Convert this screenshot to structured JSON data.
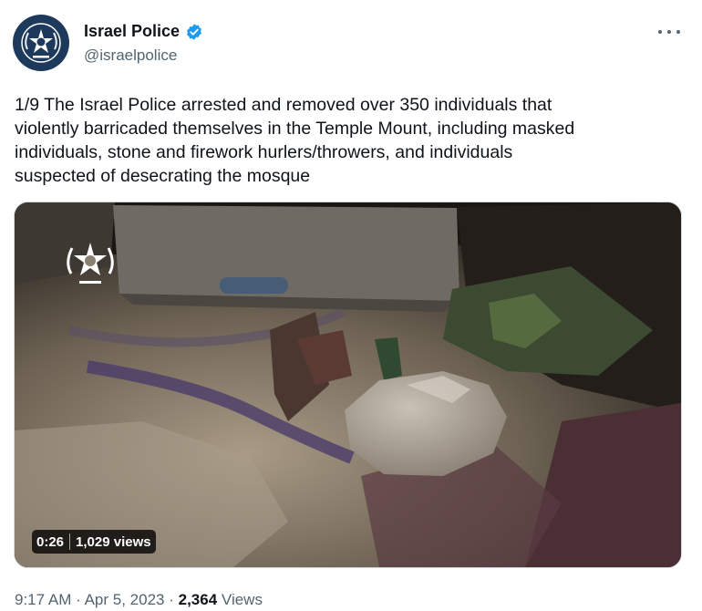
{
  "author": {
    "display_name": "Israel Police",
    "handle": "@israelpolice"
  },
  "tweet": {
    "text": "1/9 The Israel Police arrested and removed over 350 individuals that\nviolently barricaded themselves in the Temple Mount, including masked\nindividuals, stone and firework hurlers/throwers, and individuals\nsuspected of desecrating the mosque"
  },
  "media": {
    "duration": "0:26",
    "views": "1,029 views"
  },
  "meta": {
    "time": "9:17 AM",
    "date": "Apr 5, 2023",
    "view_count": "2,364",
    "views_label": "Views",
    "separator": "·"
  },
  "icons": {
    "verified": "verified-badge-icon",
    "more": "more-options-icon",
    "police_emblem": "police-star-emblem-icon"
  },
  "colors": {
    "verified_blue": "#1d9bf0",
    "secondary_text": "#536471",
    "primary_text": "#0f1419"
  }
}
